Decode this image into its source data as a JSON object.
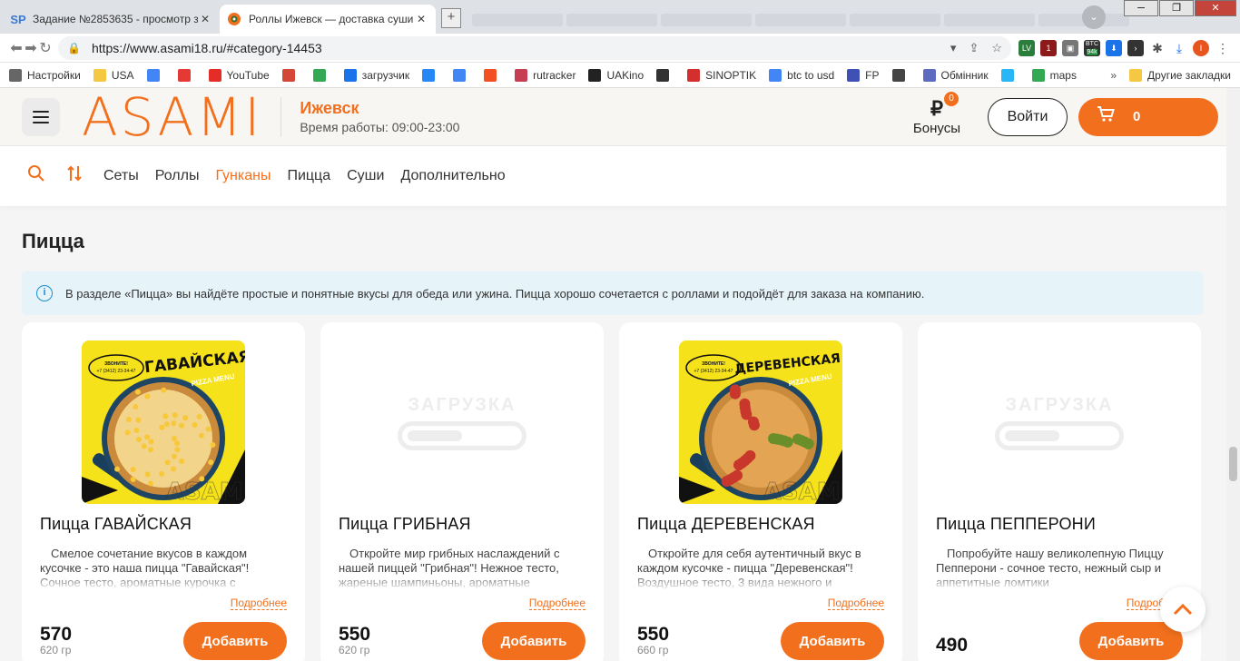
{
  "browser": {
    "tabs": [
      {
        "favicon": "SP",
        "title": "Задание №2853635 - просмотр з"
      },
      {
        "favicon": "roll-icon",
        "title": "Роллы Ижевск — доставка суши"
      }
    ],
    "url": "https://www.asami18.ru/#category-14453",
    "extensions": {
      "btc_label": "BTC",
      "btc_value": "94k",
      "lv": "LV",
      "count": "1"
    },
    "bookmarks": [
      {
        "label": "Настройки",
        "icon": "gear-icon",
        "color": "#666"
      },
      {
        "label": "USA",
        "icon": "folder-icon",
        "color": "#f4c842"
      },
      {
        "label": "",
        "icon": "google-icon",
        "color": "#4285f4"
      },
      {
        "label": "",
        "icon": "yandex-icon",
        "color": "#e53935"
      },
      {
        "label": "YouTube",
        "icon": "youtube-icon",
        "color": "#e52d27"
      },
      {
        "label": "",
        "icon": "gmail-icon",
        "color": "#d44638"
      },
      {
        "label": "",
        "icon": "drive-icon",
        "color": "#34a853"
      },
      {
        "label": "загрузчик",
        "icon": "loader-icon",
        "color": "#1a73e8"
      },
      {
        "label": "",
        "icon": "vk-icon",
        "color": "#2787f5"
      },
      {
        "label": "",
        "icon": "translate-icon",
        "color": "#4285f4"
      },
      {
        "label": "",
        "icon": "f-icon",
        "color": "#f25022"
      },
      {
        "label": "rutracker",
        "icon": "rutracker-icon",
        "color": "#c73e52"
      },
      {
        "label": "UAKino",
        "icon": "uakino-icon",
        "color": "#222"
      },
      {
        "label": "",
        "icon": "chess-icon",
        "color": "#333"
      },
      {
        "label": "SINOPTIK",
        "icon": "thermometer-icon",
        "color": "#d32f2f"
      },
      {
        "label": "btc to usd",
        "icon": "google-icon",
        "color": "#4285f4"
      },
      {
        "label": "FP",
        "icon": "fp-icon",
        "color": "#3f51b5"
      },
      {
        "label": "",
        "icon": "bc-icon",
        "color": "#444"
      },
      {
        "label": "Обмінник",
        "icon": "exchange-icon",
        "color": "#5c6bc0"
      },
      {
        "label": "",
        "icon": "star-icon",
        "color": "#29b6f6"
      },
      {
        "label": "maps",
        "icon": "maps-icon",
        "color": "#34a853"
      }
    ],
    "other_bookmarks": "Другие закладки"
  },
  "header": {
    "logo": "ASAMI",
    "city": "Ижевск",
    "hours": "Время работы: 09:00-23:00",
    "bonus_symbol": "₽",
    "bonus_count": "0",
    "bonus_label": "Бонусы",
    "login_label": "Войти",
    "cart_count": "0"
  },
  "categories": [
    "Сеты",
    "Роллы",
    "Гунканы",
    "Пицца",
    "Суши",
    "Дополнительно"
  ],
  "active_category": "Гунканы",
  "section": {
    "title": "Пицца",
    "info": "В разделе «Пицца» вы найдёте простые и понятные вкусы для обеда или ужина. Пицца хорошо сочетается с роллами и подойдёт для заказа на компанию."
  },
  "products": [
    {
      "name": "Пицца ГАВАЙСКАЯ",
      "image": "loaded",
      "banner": "ГАВАЙСКАЯ",
      "banner_sub": "PIZZA MENU",
      "phone_top": "ЗВОНИТЕ!",
      "phone": "+7 (3412) 23-34-47",
      "watermark": "ASAMI",
      "desc": "Смелое сочетание вкусов в каждом кусочке - это наша пицца \"Гавайская\"! Сочное тесто, ароматные курочка с",
      "more": "Подробнее",
      "price": "570",
      "weight": "620 гр",
      "add": "Добавить"
    },
    {
      "name": "Пицца ГРИБНАЯ",
      "image": "loading",
      "placeholder": "ЗАГРУЗКА",
      "desc": "Откройте мир грибных наслаждений с нашей пиццей \"Грибная\"! Нежное тесто, жареные шампиньоны, ароматные",
      "more": "Подробнее",
      "price": "550",
      "weight": "620 гр",
      "add": "Добавить"
    },
    {
      "name": "Пицца ДЕРЕВЕНСКАЯ",
      "image": "loaded",
      "banner": "ДЕРЕВЕНСКАЯ",
      "banner_sub": "PIZZA MENU",
      "phone_top": "ЗВОНИТЕ!",
      "phone": "+7 (3412) 23-34-47",
      "watermark": "ASAMI",
      "desc": "Откройте для себя аутентичный вкус в каждом кусочке - пицца \"Деревенская\"! Воздушное тесто, 3 вида нежного и",
      "more": "Подробнее",
      "price": "550",
      "weight": "660 гр",
      "add": "Добавить"
    },
    {
      "name": "Пицца ПЕППЕРОНИ",
      "image": "loading",
      "placeholder": "ЗАГРУЗКА",
      "desc": "Попробуйте нашу великолепную Пиццу Пепперони - сочное тесто, нежный сыр и аппетитные ломтики",
      "more": "Подробнее",
      "price": "490",
      "weight": "",
      "add": "Добавить"
    }
  ],
  "colors": {
    "accent": "#f2701d",
    "info_bg": "#e6f3f9",
    "info_icon": "#1b8fd2"
  }
}
